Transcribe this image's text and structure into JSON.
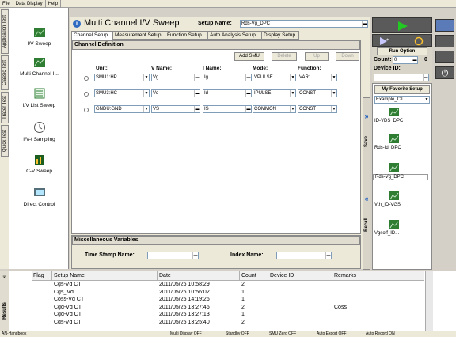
{
  "menu": [
    "File",
    "Data Display",
    "Help"
  ],
  "vtabs": [
    "Application Test",
    "Classic Test",
    "Tracer Test",
    "Quick Test"
  ],
  "left_items": [
    {
      "label": "I/V Sweep",
      "icon": "iv-sweep-icon"
    },
    {
      "label": "Multi Channel I...",
      "icon": "multi-channel-icon"
    },
    {
      "label": "I/V List Sweep",
      "icon": "iv-list-icon"
    },
    {
      "label": "I/V-t Sampling",
      "icon": "timer-icon"
    },
    {
      "label": "C-V Sweep",
      "icon": "cv-sweep-icon"
    },
    {
      "label": "Direct Control",
      "icon": "direct-control-icon"
    }
  ],
  "title": "Multi Channel I/V Sweep",
  "setup_name_label": "Setup Name:",
  "setup_name_value": "Rds-Vg_DPC",
  "tabs": [
    "Channel Setup",
    "Measurement Setup",
    "Function Setup",
    "Auto Analysis Setup",
    "Display Setup"
  ],
  "channel_definition": "Channel Definition",
  "buttons": {
    "add_smu": "Add SMU",
    "delete": "Delete",
    "up": "Up",
    "down": "Down"
  },
  "columns": {
    "unit": "Unit:",
    "vname": "V Name:",
    "iname": "I Name:",
    "mode": "Mode:",
    "function": "Function:"
  },
  "rows": [
    {
      "unit": "SMU1:HP",
      "vname": "Vg",
      "iname": "Ig",
      "mode": "VPULSE",
      "function": "VAR1"
    },
    {
      "unit": "SMU3:HC",
      "vname": "Vd",
      "iname": "Id",
      "mode": "IPULSE",
      "function": "CONST"
    },
    {
      "unit": "GNDU:GND",
      "vname": "VS",
      "iname": "IS",
      "mode": "COMMON",
      "function": "CONST"
    }
  ],
  "misc": {
    "header": "Miscellaneous Variables",
    "time_stamp": "Time Stamp Name:",
    "index": "Index Name:"
  },
  "save_label": "Save",
  "recall_label": "Recall",
  "run_option": "Run Option",
  "count_label": "Count:",
  "count_value": "0",
  "count_right": "0",
  "device_id_label": "Device ID:",
  "favorite_label": "My Favorite Setup",
  "favorite_select": "Example_CT",
  "favorites": [
    "ID-VDS_DPC",
    "Rds-Id_DPC",
    "Rds-Vg_DPC",
    "Vth_ID-VGS",
    "Vgsoff_ID..."
  ],
  "results_tab": "Results",
  "results_headers": [
    "Flag",
    "Setup Name",
    "Date",
    "Count",
    "Device ID",
    "Remarks"
  ],
  "results_rows": [
    {
      "setup": "Cgs-Vd CT",
      "date": "2011/05/26 10:58:29",
      "count": "2",
      "device": "",
      "remarks": ""
    },
    {
      "setup": "Cgs_Vd",
      "date": "2011/05/26 10:56:02",
      "count": "1",
      "device": "",
      "remarks": ""
    },
    {
      "setup": "Coss-Vd CT",
      "date": "2011/05/25 14:19:26",
      "count": "1",
      "device": "",
      "remarks": ""
    },
    {
      "setup": "Cgd-Vd CT",
      "date": "2011/05/25 13:27:46",
      "count": "2",
      "device": "",
      "remarks": "Coss"
    },
    {
      "setup": "Cgd-Vd CT",
      "date": "2011/05/25 13:27:13",
      "count": "1",
      "device": "",
      "remarks": ""
    },
    {
      "setup": "Cds-Vd CT",
      "date": "2011/05/25 13:25:40",
      "count": "2",
      "device": "",
      "remarks": ""
    }
  ],
  "status": {
    "left": "AN-Handbook",
    "items": [
      "Multi Display OFF",
      "Standby OFF",
      "SMU Zero OFF",
      "Auto Export OFF",
      "Auto Record ON"
    ]
  },
  "colors": {
    "accent_green": "#1aa31a",
    "header_blue": "#2f6bc1"
  }
}
